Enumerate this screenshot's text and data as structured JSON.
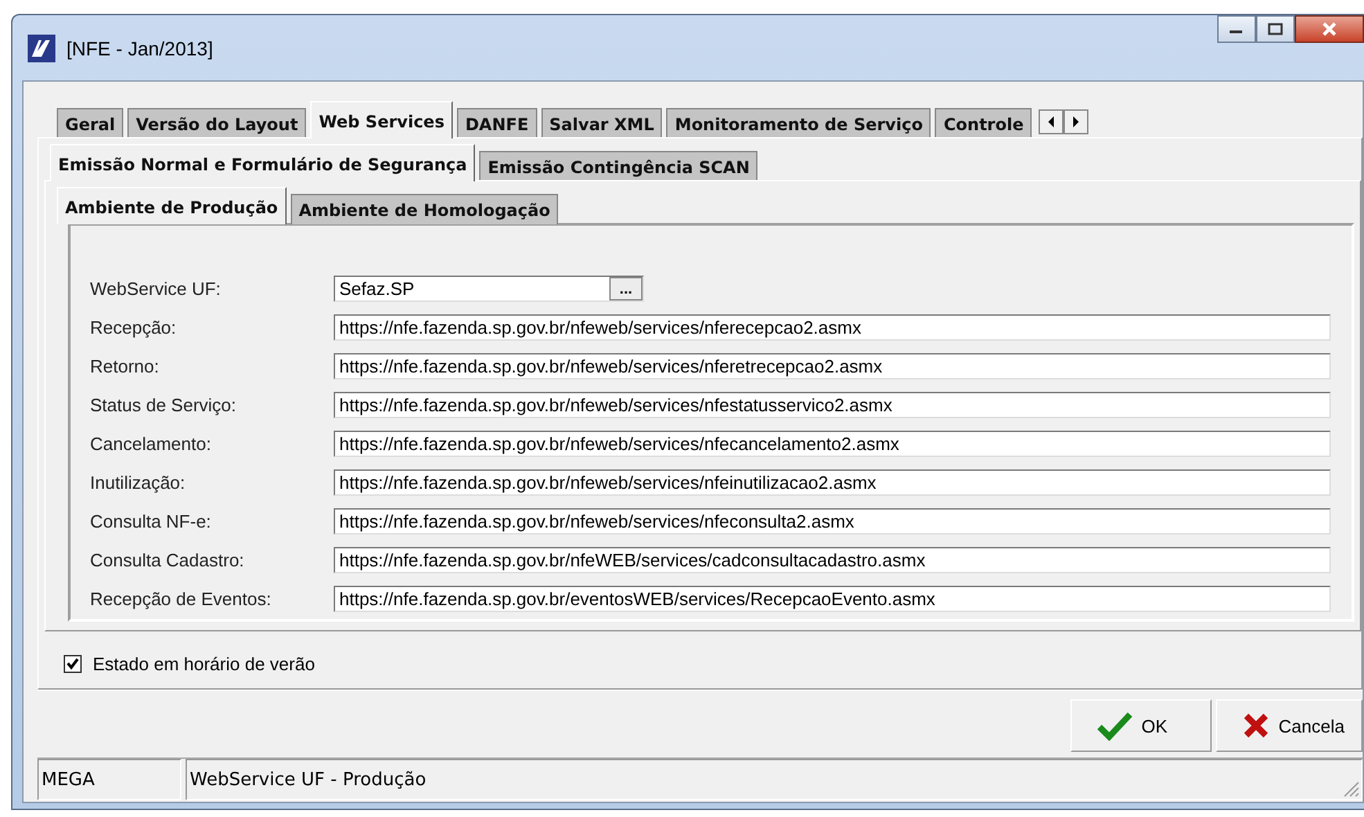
{
  "window": {
    "title": "[NFE - Jan/2013]"
  },
  "tabs": [
    {
      "label": "Geral",
      "selected": false
    },
    {
      "label": "Versão do Layout",
      "selected": false
    },
    {
      "label": "Web Services",
      "selected": true
    },
    {
      "label": "DANFE",
      "selected": false
    },
    {
      "label": "Salvar XML",
      "selected": false
    },
    {
      "label": "Monitoramento de Serviço",
      "selected": false
    },
    {
      "label": "Controle",
      "selected": false
    }
  ],
  "subtabs": [
    {
      "label": "Emissão Normal e Formulário de Segurança",
      "selected": true
    },
    {
      "label": "Emissão Contingência SCAN",
      "selected": false
    }
  ],
  "environment_tabs": [
    {
      "label": "Ambiente de Produção",
      "selected": true
    },
    {
      "label": "Ambiente de Homologação",
      "selected": false
    }
  ],
  "fields": [
    {
      "kind": "picker",
      "label": "WebService UF:",
      "value": "Sefaz.SP",
      "action": "..."
    },
    {
      "kind": "text",
      "label": "Recepção:",
      "value": "https://nfe.fazenda.sp.gov.br/nfeweb/services/nferecepcao2.asmx"
    },
    {
      "kind": "text",
      "label": "Retorno:",
      "value": "https://nfe.fazenda.sp.gov.br/nfeweb/services/nferetrecepcao2.asmx"
    },
    {
      "kind": "text",
      "label": "Status de Serviço:",
      "value": "https://nfe.fazenda.sp.gov.br/nfeweb/services/nfestatusservico2.asmx"
    },
    {
      "kind": "text",
      "label": "Cancelamento:",
      "value": "https://nfe.fazenda.sp.gov.br/nfeweb/services/nfecancelamento2.asmx"
    },
    {
      "kind": "text",
      "label": "Inutilização:",
      "value": "https://nfe.fazenda.sp.gov.br/nfeweb/services/nfeinutilizacao2.asmx"
    },
    {
      "kind": "text",
      "label": "Consulta NF-e:",
      "value": "https://nfe.fazenda.sp.gov.br/nfeweb/services/nfeconsulta2.asmx"
    },
    {
      "kind": "text",
      "label": "Consulta Cadastro:",
      "value": "https://nfe.fazenda.sp.gov.br/nfeWEB/services/cadconsultacadastro.asmx"
    },
    {
      "kind": "text",
      "label": "Recepção de Eventos:",
      "value": "https://nfe.fazenda.sp.gov.br/eventosWEB/services/RecepcaoEvento.asmx"
    }
  ],
  "checkbox": {
    "label": "Estado em horário de verão",
    "checked": true
  },
  "buttons": [
    {
      "kind": "ok",
      "label": "OK"
    },
    {
      "kind": "cancel",
      "label": "Cancela"
    }
  ],
  "status_bar": [
    "MEGA",
    "WebService UF - Produção"
  ]
}
